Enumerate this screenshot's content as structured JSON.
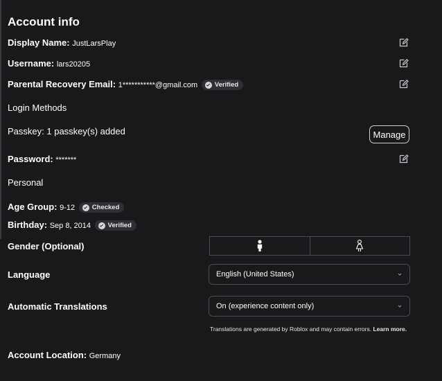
{
  "title": "Account info",
  "display_name": {
    "label": "Display Name:",
    "value": "JustLarsPlay"
  },
  "username": {
    "label": "Username:",
    "value": "lars20205"
  },
  "parental_email": {
    "label": "Parental Recovery Email:",
    "value": "1***********@gmail.com",
    "badge": "Verified"
  },
  "login_methods_heading": "Login Methods",
  "passkey": {
    "label": "Passkey:",
    "value": "1 passkey(s) added",
    "button": "Manage"
  },
  "password": {
    "label": "Password:",
    "value": "*******"
  },
  "personal_heading": "Personal",
  "age_group": {
    "label": "Age Group:",
    "value": "9-12",
    "badge": "Checked"
  },
  "birthday": {
    "label": "Birthday:",
    "value": "Sep 8, 2014",
    "badge": "Verified"
  },
  "gender": {
    "label": "Gender (Optional)",
    "options": [
      "male-icon",
      "female-icon"
    ]
  },
  "language": {
    "label": "Language",
    "selected": "English (United States)"
  },
  "translations": {
    "label": "Automatic Translations",
    "selected": "On (experience content only)",
    "note": "Translations are generated by Roblox and may contain errors.",
    "link": "Learn more."
  },
  "location": {
    "label": "Account Location:",
    "value": "Germany"
  },
  "colors": {
    "background": "#19191b",
    "text": "#ffffff",
    "border": "#4b4c51",
    "badge_bg": "#2f3034"
  }
}
